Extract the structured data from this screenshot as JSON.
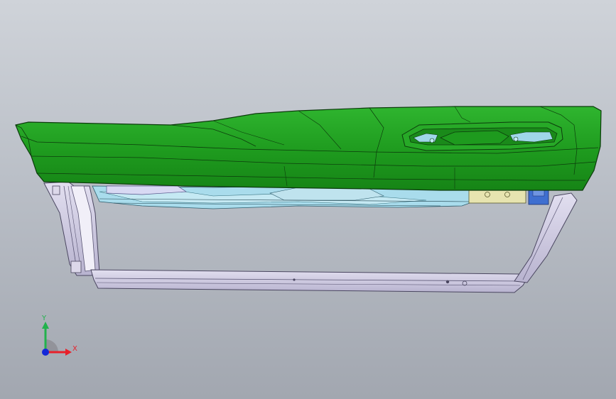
{
  "viewport": {
    "background_top": "#cfd3d9",
    "background_bottom": "#a2a7b0"
  },
  "model": {
    "trim_panel_color": "#1f9d1f",
    "trim_panel_edge_color": "#0c3b0c",
    "frame_color": "#cdc9df",
    "frame_edge_color": "#4a4660",
    "inner_parts_color": "#9fd6e8",
    "bracket_color": "#e7e4b0"
  },
  "triad": {
    "x_label": "X",
    "y_label": "Y",
    "x_axis_color": "#e8202a",
    "y_axis_color": "#22b24c",
    "z_axis_color": "#1428d8"
  }
}
